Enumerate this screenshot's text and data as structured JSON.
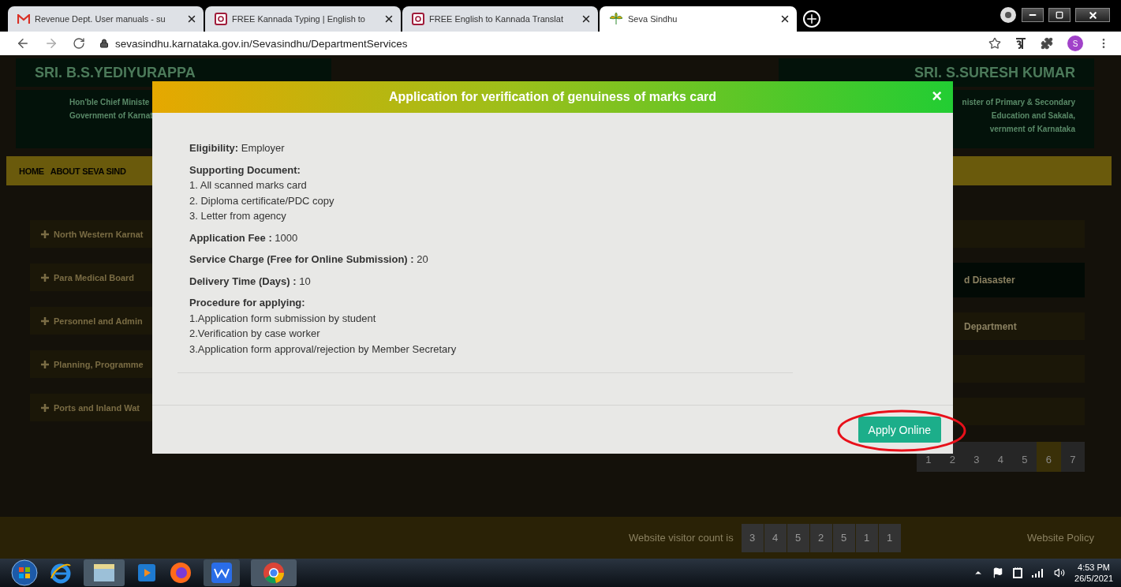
{
  "browser": {
    "tabs": [
      {
        "title": "Revenue Dept. User manuals - su",
        "selected": false
      },
      {
        "title": "FREE Kannada Typing | English to",
        "selected": false
      },
      {
        "title": "FREE English to Kannada Translat",
        "selected": false
      },
      {
        "title": "Seva Sindhu",
        "selected": true
      }
    ],
    "address": "sevasindhu.karnataka.gov.in/Sevasindhu/DepartmentServices",
    "profile_initial": "S"
  },
  "page": {
    "header": {
      "left": {
        "name": "SRI. B.S.YEDIYURAPPA",
        "lines": [
          "Hon'ble Chief Ministe",
          "Government of Karnat"
        ]
      },
      "right": {
        "name": "SRI. S.SURESH KUMAR",
        "lines": [
          "nister of Primary & Secondary",
          "Education and Sakala,",
          "vernment of Karnataka"
        ]
      }
    },
    "nav": [
      "HOME",
      "ABOUT SEVA SIND"
    ],
    "departments": [
      "North Western Karnat",
      "Para Medical Board",
      "Personnel and Admin",
      "Planning, Programme",
      "Ports and Inland Wat"
    ],
    "services": [
      {
        "selected": false
      },
      {
        "text": "d Diasaster",
        "selected": true
      },
      {
        "text": "Department",
        "selected": false
      },
      {
        "selected": false
      },
      {
        "selected": false
      }
    ],
    "pagination": [
      {
        "label": "1",
        "selected": false
      },
      {
        "label": "2",
        "selected": false
      },
      {
        "label": "3",
        "selected": false
      },
      {
        "label": "4",
        "selected": false
      },
      {
        "label": "5",
        "selected": false
      },
      {
        "label": "6",
        "selected": true
      },
      {
        "label": "7",
        "selected": false
      }
    ],
    "footer": {
      "visitor_label": "Website visitor count is",
      "visitor_digits": [
        "3",
        "4",
        "5",
        "2",
        "5",
        "1",
        "1"
      ],
      "policy": "Website Policy"
    }
  },
  "modal": {
    "title": "Application for verification of genuiness of marks card",
    "close": "×",
    "sections": [
      {
        "kind": "field",
        "label": "Eligibility:",
        "value": "Employer"
      },
      {
        "kind": "list",
        "label": "Supporting Document:",
        "items": [
          "1. All scanned marks card",
          "2. Diploma certificate/PDC copy",
          "3. Letter from agency"
        ]
      },
      {
        "kind": "field",
        "label": "Application Fee :",
        "value": "1000"
      },
      {
        "kind": "field",
        "label": "Service Charge (Free for Online Submission) :",
        "value": "20"
      },
      {
        "kind": "field",
        "label": "Delivery Time (Days) :",
        "value": "10"
      },
      {
        "kind": "list",
        "label": "Procedure for applying:",
        "items": [
          "1.Application form submission by student",
          "2.Verification by case worker",
          "3.Application form approval/rejection by Member Secretary"
        ]
      }
    ],
    "button": "Apply Online"
  },
  "taskbar": {
    "time": "4:53 PM",
    "date": "26/5/2021"
  }
}
